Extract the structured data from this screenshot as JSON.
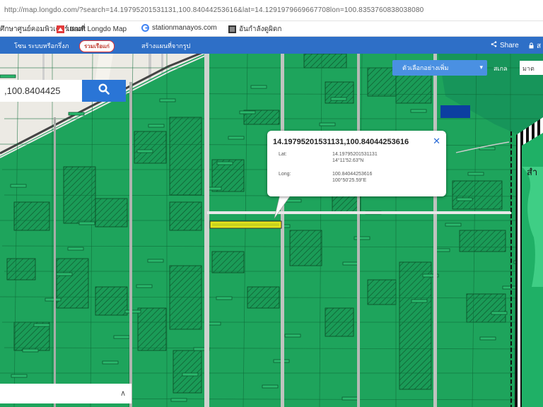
{
  "browser": {
    "address": "http://map.longdo.com/?search=14.19795201531131,100.84044253616&lat=14.1291979669667708lon=100.8353760838038080",
    "bookmarks": [
      {
        "label": "ศึกษาศูนย์คอมพิวเตอร์ ttsoft",
        "icon": "page-icon"
      },
      {
        "label": "แผนที่ Longdo Map",
        "icon": "map-icon"
      },
      {
        "label": "stationmanayos.com",
        "icon": "google-icon"
      },
      {
        "label": "อันกำลังดูผิดก",
        "icon": "video-icon"
      }
    ]
  },
  "toolbar": {
    "item1": "โซน ระบบหรือกรึ่งภ",
    "badge": "รวมเรือแก่",
    "item2": "สร้างแผนที่จากรูป",
    "share": "Share",
    "right_item": "ส"
  },
  "search": {
    "value": ",100.8404425"
  },
  "layer": {
    "label": "ตัวเลือกอย่างเพิ่ม",
    "zoom_label": "สเกล",
    "zoom_value": "มาต"
  },
  "popup": {
    "title": "14.19795201531131,100.84044253616",
    "lat_label": "Lat:",
    "lat_decimal": "14.19795201531131",
    "lat_dms": "14°11'52.63\"N",
    "long_label": "Long:",
    "long_decimal": "100.84044253616",
    "long_dms": "100°50'25.59\"E"
  },
  "map_labels": {
    "right_area": "สำ"
  },
  "colors": {
    "field": "#1ea45c",
    "field_dark": "#169a54",
    "river": "#9bc3e6",
    "road": "#c8c8c8",
    "plot_line": "#0c5a30",
    "highlight": "#e6e61a",
    "toolbar_blue": "#2e6fc7",
    "accent_blue": "#2a75d6"
  }
}
